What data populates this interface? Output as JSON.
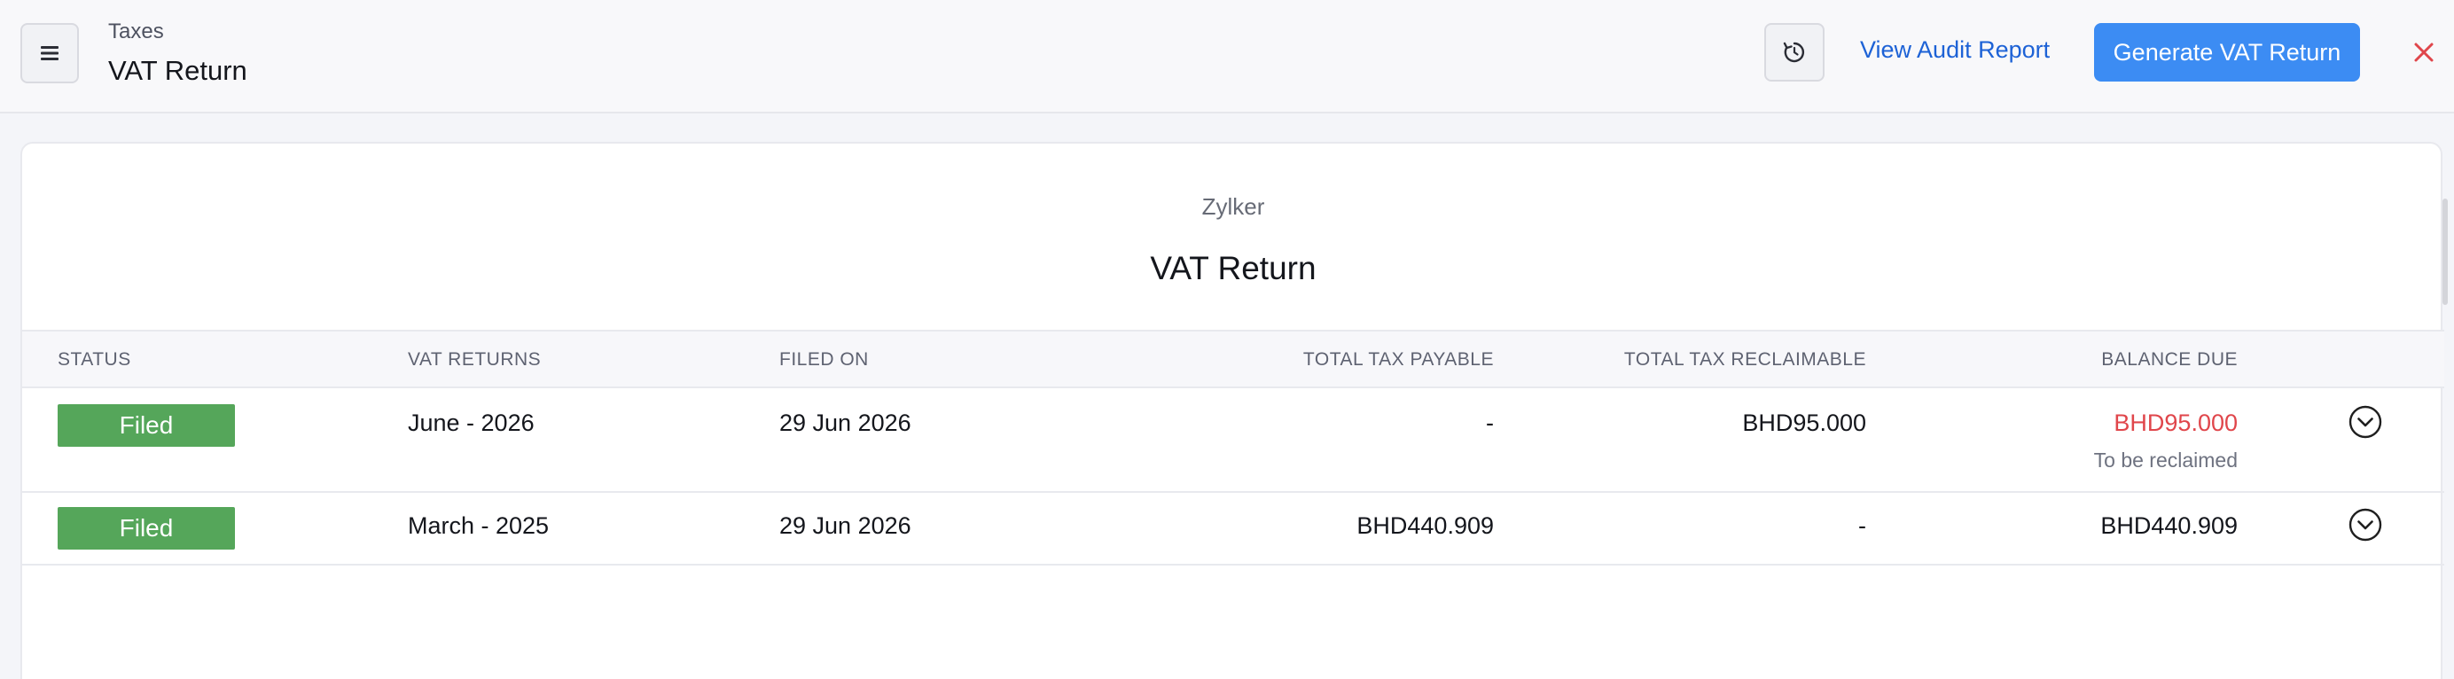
{
  "header": {
    "breadcrumb": "Taxes",
    "title": "VAT Return",
    "audit_link": "View Audit Report",
    "generate_button": "Generate VAT Return",
    "icons": {
      "menu": "hamburger-menu-icon",
      "refresh": "refresh-icon",
      "close": "close-icon"
    }
  },
  "report": {
    "organization": "Zylker",
    "title": "VAT Return"
  },
  "table": {
    "columns": {
      "status": "STATUS",
      "vat_returns": "VAT RETURNS",
      "filed_on": "FILED ON",
      "total_tax_payable": "TOTAL TAX PAYABLE",
      "total_tax_reclaimable": "TOTAL TAX RECLAIMABLE",
      "balance_due": "BALANCE DUE"
    },
    "rows": [
      {
        "status": "Filed",
        "period": "June - 2026",
        "filed_on": "29 Jun 2026",
        "total_tax_payable": "-",
        "total_tax_reclaimable": "BHD95.000",
        "balance_due": "BHD95.000",
        "balance_note": "To be reclaimed"
      },
      {
        "status": "Filed",
        "period": "March - 2025",
        "filed_on": "29 Jun 2026",
        "total_tax_payable": "BHD440.909",
        "total_tax_reclaimable": "-",
        "balance_due": "BHD440.909"
      }
    ]
  },
  "colors": {
    "primary_button": "#3c8cf3",
    "link": "#1d62d6",
    "filed_badge": "#55a65a",
    "balance_red": "#e0464b",
    "close_red": "#e0464b"
  }
}
